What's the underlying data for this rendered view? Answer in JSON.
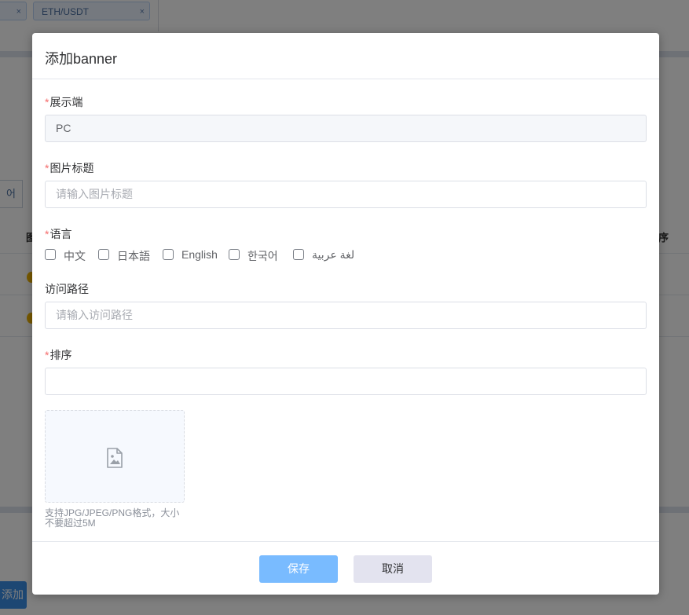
{
  "background": {
    "tag_a": "×",
    "tag_b": "ETH/USDT",
    "tag_b_close": "×",
    "tab_fragment": "어",
    "header_left": "图",
    "header_right": "序",
    "add_button": "添加"
  },
  "dialog": {
    "title": "添加banner",
    "fields": {
      "platform": {
        "required": "*",
        "label": "展示端",
        "value": "PC"
      },
      "image_title": {
        "required": "*",
        "label": "图片标题",
        "placeholder": "请输入图片标题"
      },
      "language": {
        "required": "*",
        "label": "语言",
        "options": [
          "中文",
          "日本語",
          "English",
          "한국어",
          "لغة عربية"
        ]
      },
      "path": {
        "label": "访问路径",
        "placeholder": "请输入访问路径"
      },
      "sort": {
        "required": "*",
        "label": "排序",
        "value": ""
      }
    },
    "upload": {
      "icon": "image-icon",
      "tip": "支持JPG/JPEG/PNG格式，大小不要超过5M"
    },
    "footer": {
      "save": "保存",
      "cancel": "取消"
    }
  },
  "colors": {
    "overlay": "rgba(0,0,0,0.5)",
    "required": "#f56c6c",
    "save_button": "#79bbff",
    "cancel_button": "#e3e3ef"
  }
}
